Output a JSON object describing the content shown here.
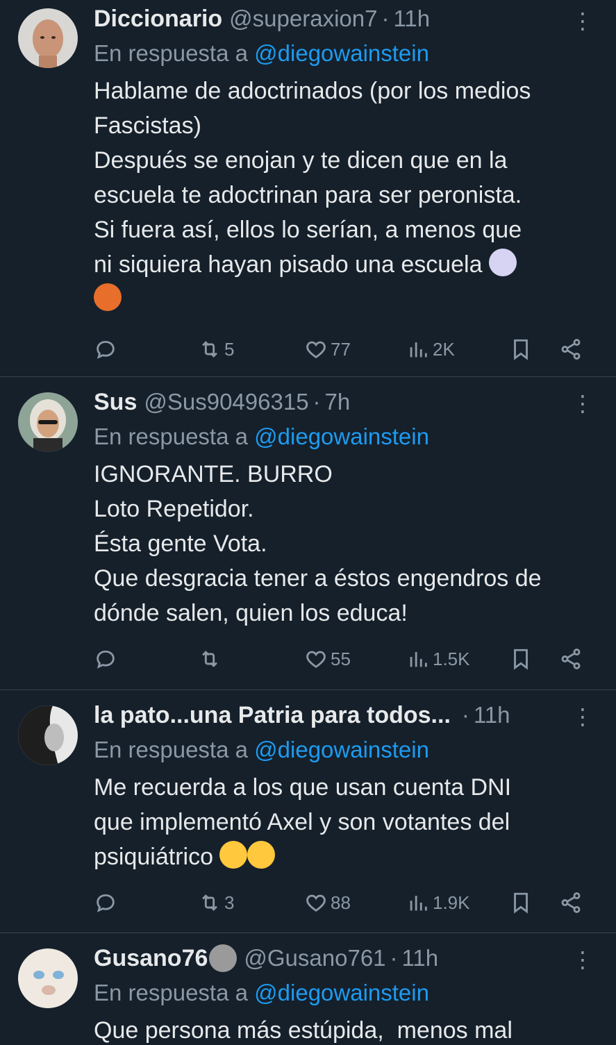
{
  "reply_prefix": "En respuesta a ",
  "tweets": [
    {
      "name": "Diccionario",
      "handle": "@superaxion7",
      "dot": "·",
      "time": "11h",
      "reply_to": "@diegowainstein",
      "text": "Hablame de adoctrinados (por los medios\nFascistas)\nDespués se enojan y te dicen que en la\nescuela te adoctrinan para ser peronista.\nSi fuera así, ellos lo serían, a menos que\nni siquiera hayan pisado una escuela",
      "emojis": [
        "woman-shrugging-emoji",
        "woman-shrugging-dark-emoji"
      ],
      "stats": {
        "replies": "",
        "retweets": "5",
        "likes": "77",
        "views": "2K"
      }
    },
    {
      "name": "Sus",
      "handle": "@Sus90496315",
      "dot": "·",
      "time": "7h",
      "reply_to": "@diegowainstein",
      "text": "IGNORANTE. BURRO\nLoto Repetidor.\nÉsta gente Vota.\nQue desgracia tener a éstos engendros de\ndónde salen, quien los educa!",
      "stats": {
        "replies": "",
        "retweets": "",
        "likes": "55",
        "views": "1.5K"
      }
    },
    {
      "name": "la pato...una Patria para todos...",
      "handle": "",
      "dot": "·",
      "time": "11h",
      "reply_to": "@diegowainstein",
      "text": "Me recuerda a los que usan cuenta DNI\nque implementó Axel y son votantes del\npsiquiátrico",
      "emojis": [
        "zany-face-emoji",
        "face-with-hand-over-mouth-emoji"
      ],
      "stats": {
        "replies": "",
        "retweets": "3",
        "likes": "88",
        "views": "1.9K"
      }
    },
    {
      "name": "Gusano76",
      "handle": "@Gusano761",
      "dot": "·",
      "time": "11h",
      "reply_to": "@diegowainstein",
      "text": "Que persona más estúpida,  menos mal",
      "emojis": [
        "raccoon-emoji"
      ]
    }
  ],
  "colors": {
    "background": "#15202b",
    "text": "#e7e9ea",
    "muted": "#8b98a5",
    "link": "#1d9bf0",
    "divider": "#38444d"
  }
}
